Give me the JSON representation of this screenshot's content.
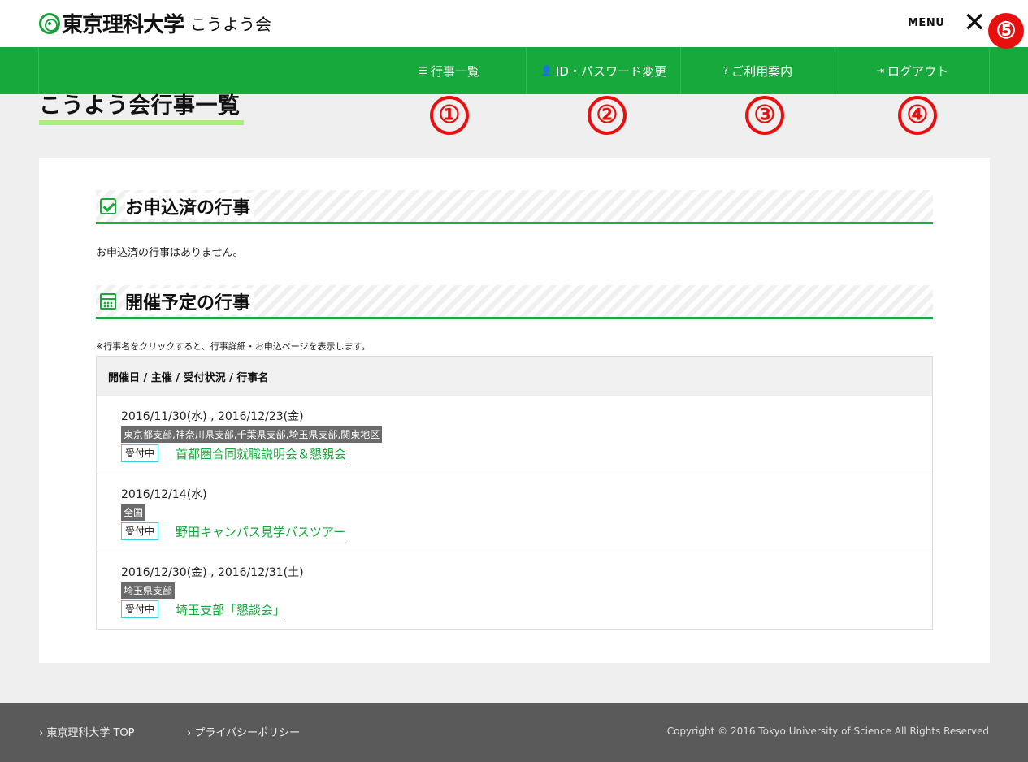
{
  "header": {
    "logo_main": "東京理科大学",
    "logo_sub": "こうよう会",
    "menu_label": "MENU",
    "close_glyph": "✕"
  },
  "nav": {
    "items": [
      {
        "label": "行事一覧",
        "icon": "list-icon",
        "glyph": "☰"
      },
      {
        "label": "ID・パスワード変更",
        "icon": "user-icon",
        "glyph": "👤"
      },
      {
        "label": "ご利用案内",
        "icon": "question-circle-icon",
        "glyph": "?"
      },
      {
        "label": "ログアウト",
        "icon": "sign-out-icon",
        "glyph": "⇥"
      }
    ]
  },
  "annotations": [
    "①",
    "②",
    "③",
    "④",
    "⑤"
  ],
  "page_title": "こうよう会行事一覧",
  "applied": {
    "heading": "お申込済の行事",
    "empty_message": "お申込済の行事はありません。"
  },
  "upcoming": {
    "heading": "開催予定の行事",
    "note": "※行事名をクリックすると、行事詳細・お申込ページを表示します。",
    "table_header": "開催日 / 主催 / 受付状況 / 行事名",
    "events": [
      {
        "date": "2016/11/30(水) , 2016/12/23(金)",
        "organizer": "東京都支部,神奈川県支部,千葉県支部,埼玉県支部,関東地区",
        "status": "受付中",
        "name": "首都圏合同就職説明会＆懇親会"
      },
      {
        "date": "2016/12/14(水)",
        "organizer": "全国",
        "status": "受付中",
        "name": "野田キャンパス見学バスツアー"
      },
      {
        "date": "2016/12/30(金) , 2016/12/31(土)",
        "organizer": "埼玉県支部",
        "status": "受付中",
        "name": "埼玉支部「懇談会」"
      }
    ]
  },
  "footer": {
    "links": [
      "› 東京理科大学 TOP",
      "› プライバシーポリシー"
    ],
    "copyright": "Copyright © 2016 Tokyo University of Science All Rights Reserved"
  },
  "colors": {
    "brand_green": "#17a93b",
    "title_underline": "#aaef80",
    "annotation_red": "#e8100f",
    "status_border": "#37cfe0",
    "footer_bg": "#5a5a5a"
  }
}
